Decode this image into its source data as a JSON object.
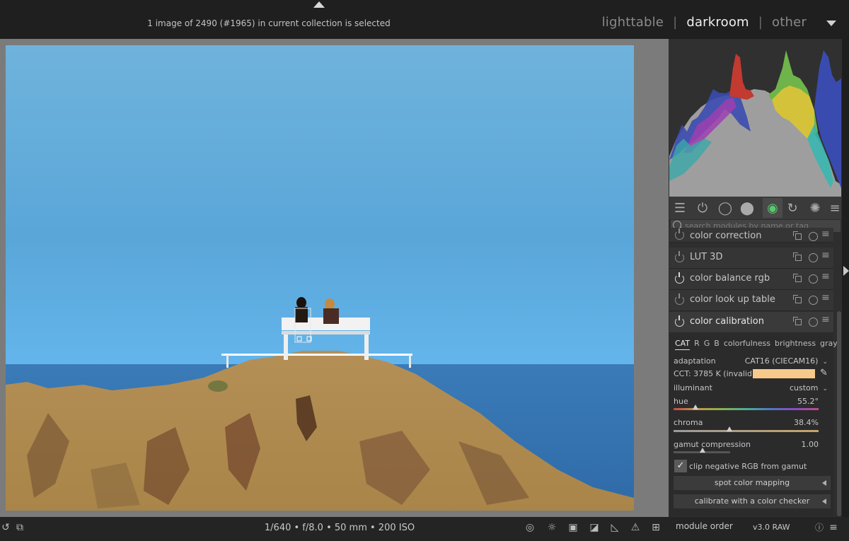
{
  "header": {
    "status_text": "1 image of 2490 (#1965) in current collection is selected",
    "views": [
      "lighttable",
      "darkroom",
      "other"
    ],
    "active_view": "darkroom"
  },
  "search": {
    "placeholder": "search modules by name or tag"
  },
  "modules": [
    {
      "name": "color correction",
      "enabled": false
    },
    {
      "name": "LUT 3D",
      "enabled": false
    },
    {
      "name": "color balance rgb",
      "enabled": true
    },
    {
      "name": "color look up table",
      "enabled": false
    },
    {
      "name": "color calibration",
      "enabled": true
    }
  ],
  "calibration": {
    "tabs": [
      "CAT",
      "R",
      "G",
      "B",
      "colorfulness",
      "brightness",
      "gray"
    ],
    "active_tab": "CAT",
    "adaptation_label": "adaptation",
    "adaptation_value": "CAT16 (CIECAM16)",
    "cct_label": "CCT: 3785 K (invalid)",
    "cct_color": "#f7c98a",
    "illuminant_label": "illuminant",
    "illuminant_value": "custom",
    "hue_label": "hue",
    "hue_value": "55.2°",
    "hue_level": 0.153,
    "chroma_label": "chroma",
    "chroma_value": "38.4%",
    "chroma_level": 0.384,
    "gamut_label": "gamut compression",
    "gamut_value": "1.00",
    "gamut_level": 0.2,
    "clip_label": "clip negative RGB from gamut",
    "clip_checked": true,
    "spot_button": "spot color mapping",
    "checker_button": "calibrate with a color checker"
  },
  "footer": {
    "exif": "1/640 • f/8.0 • 50 mm • 200 ISO",
    "module_order_label": "module order",
    "module_order_value": "v3.0 RAW"
  }
}
